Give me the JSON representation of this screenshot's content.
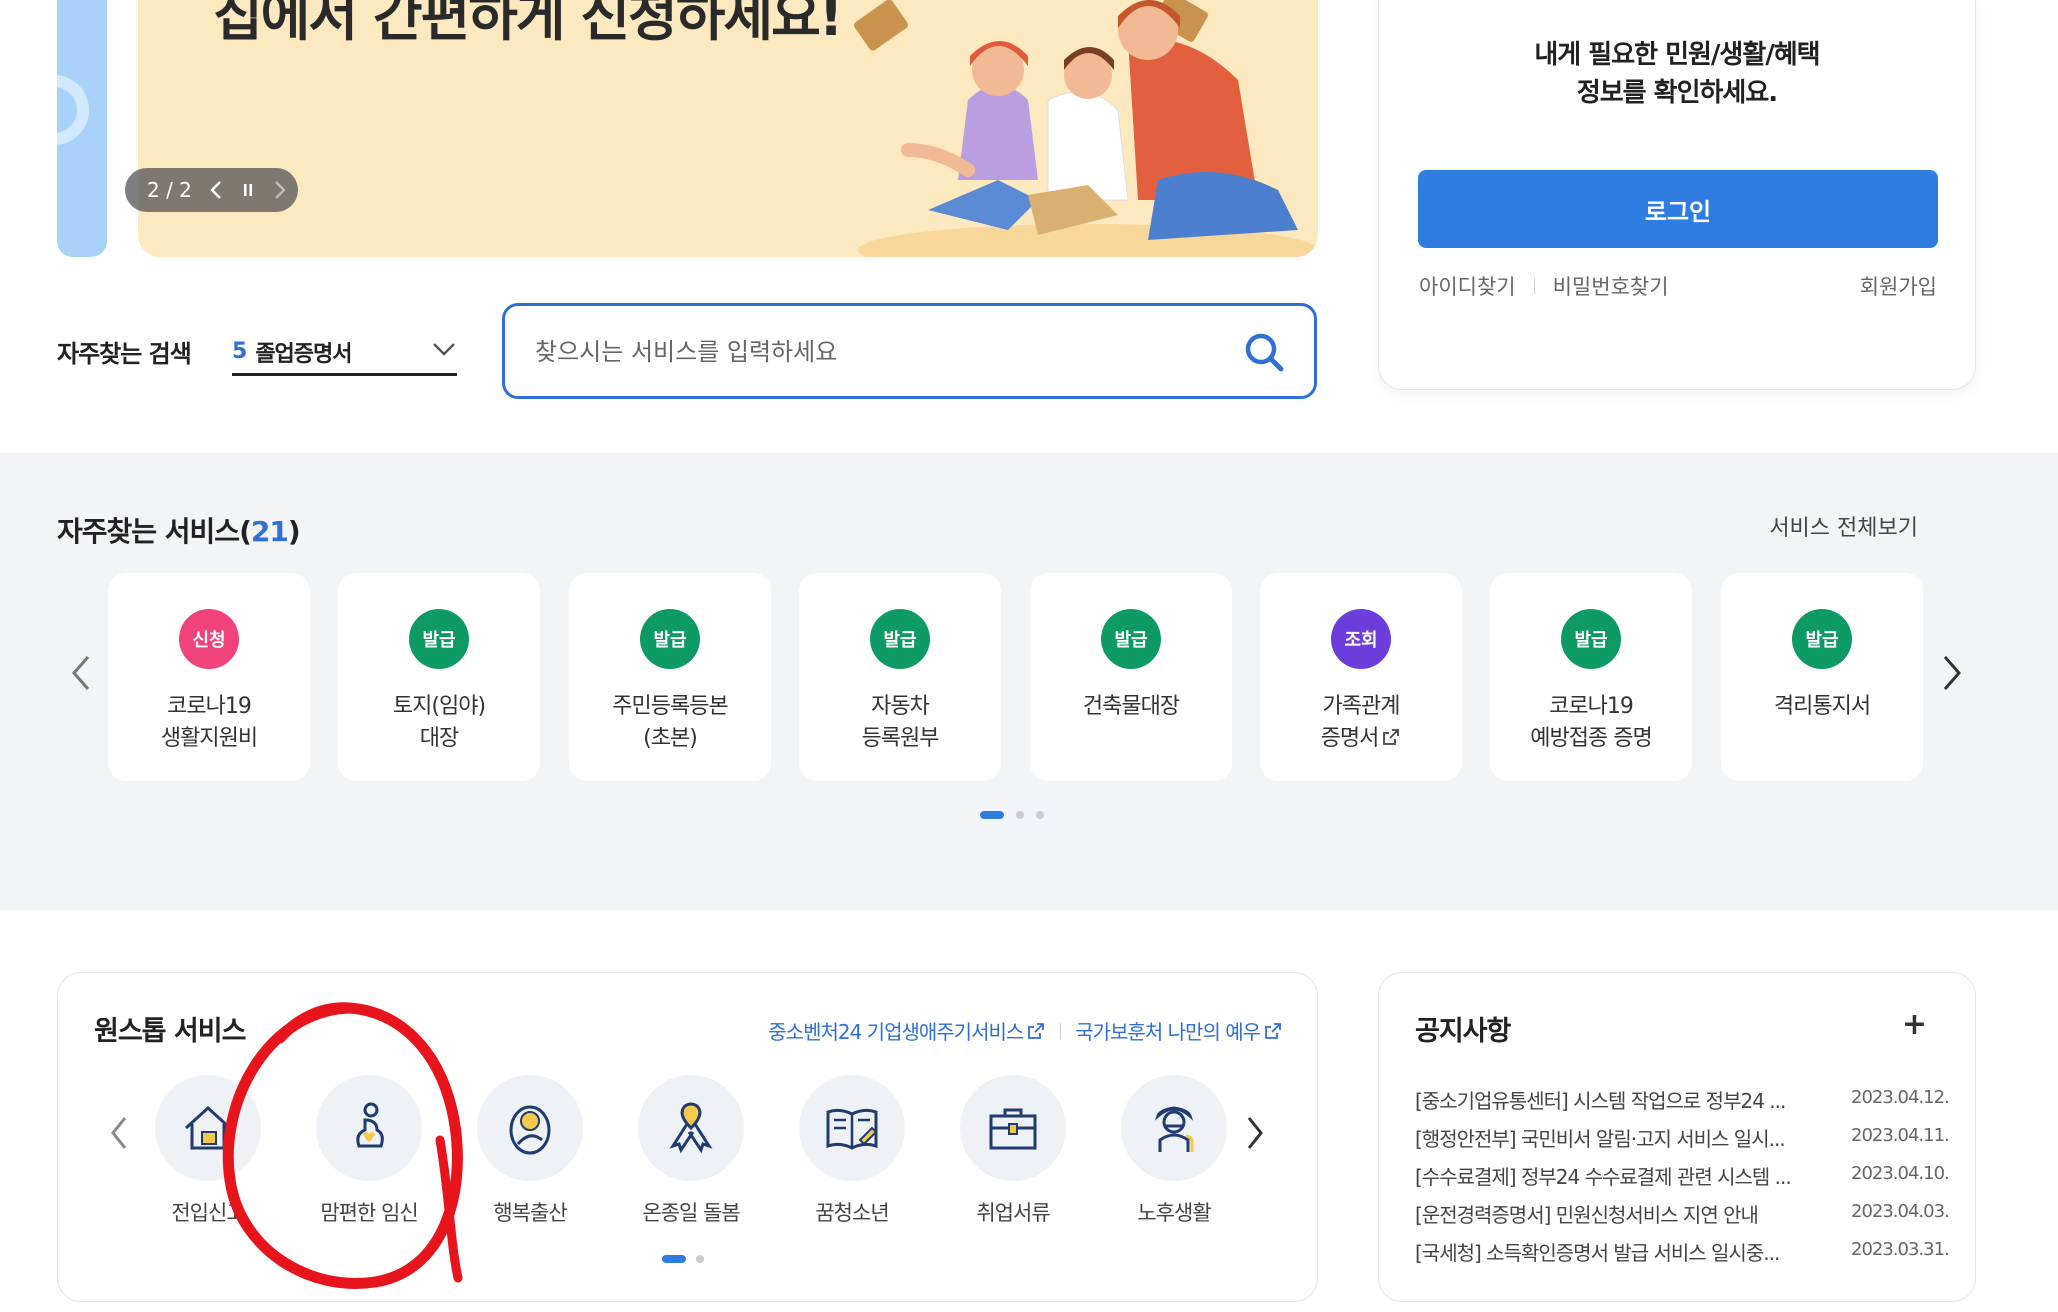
{
  "banner": {
    "title": "집에서 간편하게 신청하세요!",
    "pager_text": "2 / 2"
  },
  "search": {
    "fav_label": "자주찾는 검색",
    "fav_rank": "5",
    "fav_value": "졸업증명서",
    "placeholder": "찾으시는 서비스를 입력하세요"
  },
  "login": {
    "message_line1": "내게 필요한 민원/생활/혜택",
    "message_line2": "정보를 확인하세요.",
    "button": "로그인",
    "find_id": "아이디찾기",
    "find_pw": "비밀번호찾기",
    "signup": "회원가입",
    "button_color": "#2f7de1"
  },
  "services": {
    "title": "자주찾는 서비스(",
    "count": "21",
    "title_end": ")",
    "view_all": "서비스 전체보기",
    "items": [
      {
        "badge": "신청",
        "color": "#f0427b",
        "line1": "코로나19",
        "line2": "생활지원비"
      },
      {
        "badge": "발급",
        "color": "#0e9a64",
        "line1": "토지(임야)",
        "line2": "대장"
      },
      {
        "badge": "발급",
        "color": "#0e9a64",
        "line1": "주민등록등본",
        "line2": "(초본)"
      },
      {
        "badge": "발급",
        "color": "#0e9a64",
        "line1": "자동차",
        "line2": "등록원부"
      },
      {
        "badge": "발급",
        "color": "#0e9a64",
        "line1": "건축물대장",
        "line2": ""
      },
      {
        "badge": "조회",
        "color": "#6c3ddb",
        "line1": "가족관계",
        "line2": "증명서"
      },
      {
        "badge": "발급",
        "color": "#0e9a64",
        "line1": "코로나19",
        "line2": "예방접종 증명"
      },
      {
        "badge": "발급",
        "color": "#0e9a64",
        "line1": "격리통지서",
        "line2": ""
      }
    ]
  },
  "onestop": {
    "title": "원스톱 서비스",
    "link1": "중소벤처24 기업생애주기서비스",
    "link2": "국가보훈처 나만의 예우",
    "items": [
      {
        "label": "전입신고",
        "icon": "house-icon"
      },
      {
        "label": "맘편한 임신",
        "icon": "pregnancy-icon"
      },
      {
        "label": "행복출산",
        "icon": "baby-icon"
      },
      {
        "label": "온종일 돌봄",
        "icon": "ribbon-icon"
      },
      {
        "label": "꿈청소년",
        "icon": "book-icon"
      },
      {
        "label": "취업서류",
        "icon": "briefcase-icon"
      },
      {
        "label": "노후생활",
        "icon": "elder-icon"
      }
    ]
  },
  "notice": {
    "title": "공지사항",
    "plus": "+",
    "items": [
      {
        "text": "[중소기업유통센터] 시스템 작업으로 정부24 ...",
        "date": "2023.04.12."
      },
      {
        "text": "[행정안전부] 국민비서 알림·고지 서비스 일시...",
        "date": "2023.04.11."
      },
      {
        "text": "[수수료결제] 정부24 수수료결제 관련 시스템 ...",
        "date": "2023.04.10."
      },
      {
        "text": "[운전경력증명서] 민원신청서비스 지연 안내",
        "date": "2023.04.03."
      },
      {
        "text": "[국세청] 소득확인증명서 발급 서비스 일시중...",
        "date": "2023.03.31."
      }
    ]
  }
}
